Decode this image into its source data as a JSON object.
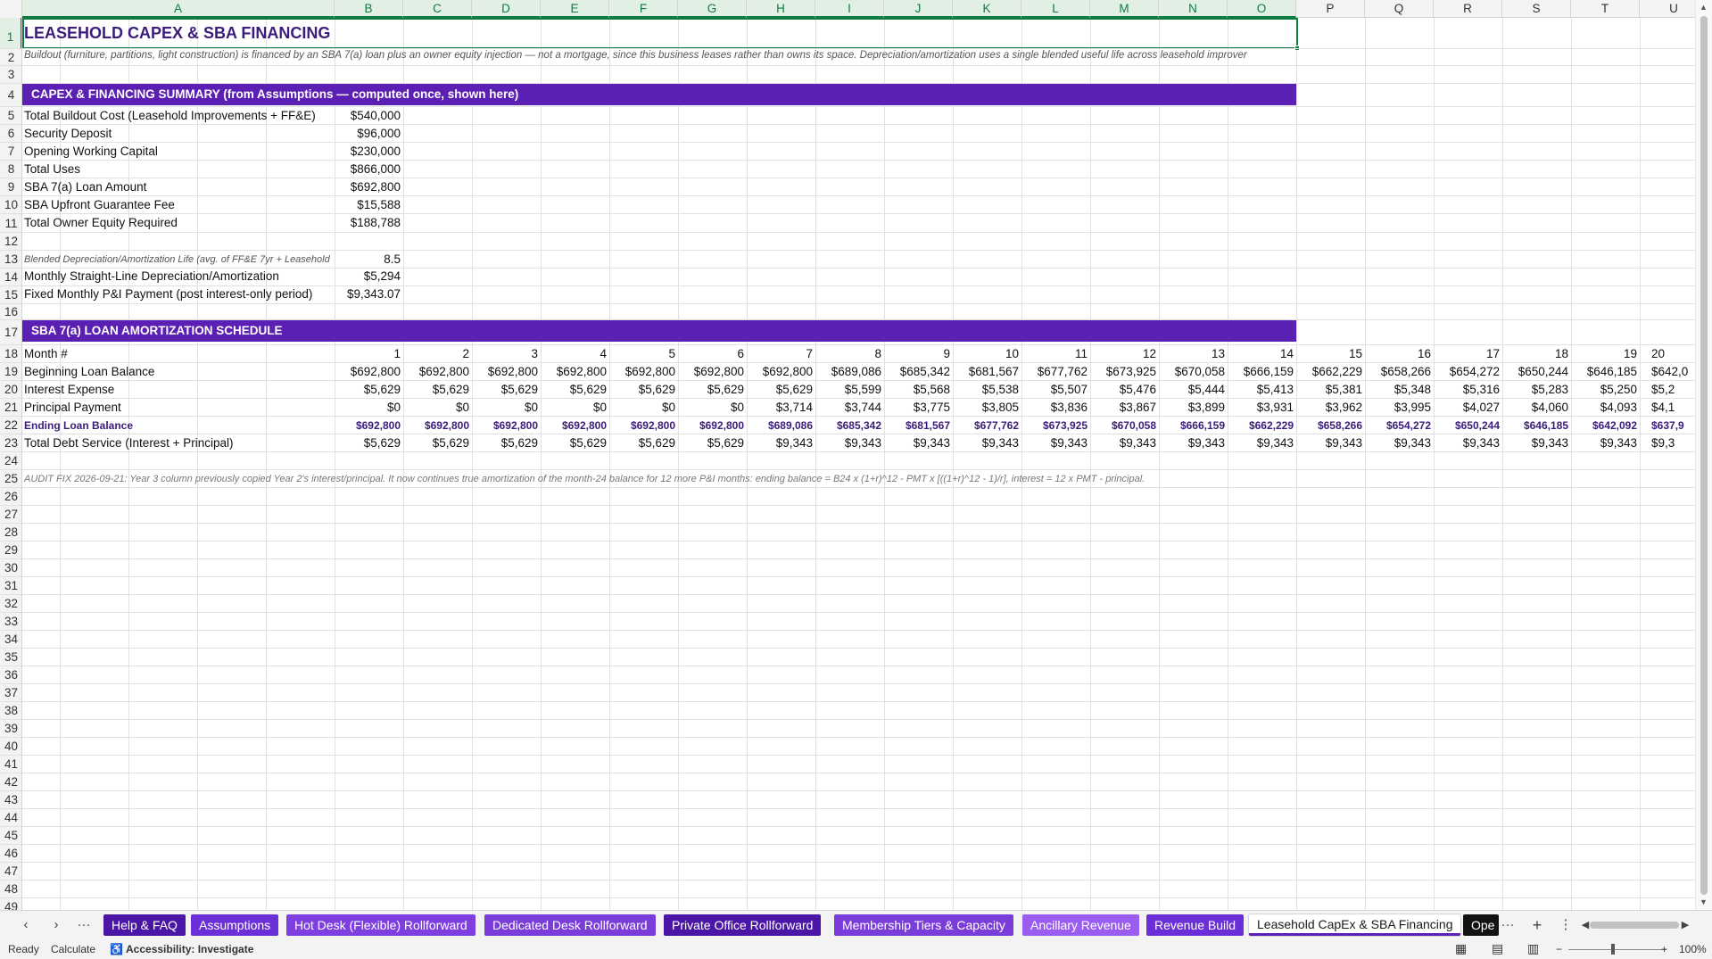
{
  "columns": [
    "A",
    "B",
    "C",
    "D",
    "E",
    "F",
    "G",
    "H",
    "I",
    "J",
    "K",
    "L",
    "M",
    "N",
    "O",
    "P",
    "Q",
    "R",
    "S",
    "T",
    "U"
  ],
  "rows": [
    "1",
    "2",
    "3",
    "4",
    "5",
    "6",
    "7",
    "8",
    "9",
    "10",
    "11",
    "12",
    "13",
    "14",
    "15",
    "16",
    "17",
    "18",
    "19",
    "20",
    "21",
    "22",
    "23",
    "24",
    "25",
    "26",
    "27",
    "28",
    "29",
    "30",
    "31",
    "32",
    "33",
    "34",
    "35",
    "36",
    "37",
    "38",
    "39",
    "40",
    "41",
    "42",
    "43",
    "44",
    "45",
    "46",
    "47",
    "48",
    "49"
  ],
  "sheet": {
    "title": "LEASEHOLD CAPEX & SBA FINANCING",
    "subtitle": "Buildout (furniture, partitions, light construction) is financed by an SBA 7(a) loan plus an owner equity injection — not a mortgage, since this business leases rather than owns its space. Depreciation/amortization uses a single blended useful life across leasehold improver",
    "summary_header": "CAPEX & FINANCING SUMMARY (from Assumptions — computed once, shown here)",
    "summary": [
      {
        "label": "Total Buildout Cost (Leasehold Improvements + FF&E)",
        "value": "$540,000"
      },
      {
        "label": "Security Deposit",
        "value": "$96,000"
      },
      {
        "label": "Opening Working Capital",
        "value": "$230,000"
      },
      {
        "label": "Total Uses",
        "value": "$866,000"
      },
      {
        "label": "SBA 7(a) Loan Amount",
        "value": "$692,800"
      },
      {
        "label": "SBA Upfront Guarantee Fee",
        "value": "$15,588"
      },
      {
        "label": "Total Owner Equity Required",
        "value": "$188,788"
      }
    ],
    "blended_life": {
      "label": "Blended Depreciation/Amortization Life (avg. of FF&E 7yr + Leasehold",
      "value": "8.5"
    },
    "monthly_dep": {
      "label": "Monthly Straight-Line Depreciation/Amortization",
      "value": "$5,294"
    },
    "fixed_pi": {
      "label": "Fixed Monthly P&I Payment (post interest-only period)",
      "value": "$9,343.07"
    },
    "amort_header": "SBA 7(a) LOAN AMORTIZATION SCHEDULE",
    "amort_rows": [
      {
        "label": "Month #",
        "values": [
          "1",
          "2",
          "3",
          "4",
          "5",
          "6",
          "7",
          "8",
          "9",
          "10",
          "11",
          "12",
          "13",
          "14",
          "15",
          "16",
          "17",
          "18",
          "19",
          "20"
        ]
      },
      {
        "label": "Beginning Loan Balance",
        "values": [
          "$692,800",
          "$692,800",
          "$692,800",
          "$692,800",
          "$692,800",
          "$692,800",
          "$692,800",
          "$689,086",
          "$685,342",
          "$681,567",
          "$677,762",
          "$673,925",
          "$670,058",
          "$666,159",
          "$662,229",
          "$658,266",
          "$654,272",
          "$650,244",
          "$646,185",
          "$642,0"
        ]
      },
      {
        "label": "Interest Expense",
        "values": [
          "$5,629",
          "$5,629",
          "$5,629",
          "$5,629",
          "$5,629",
          "$5,629",
          "$5,629",
          "$5,599",
          "$5,568",
          "$5,538",
          "$5,507",
          "$5,476",
          "$5,444",
          "$5,413",
          "$5,381",
          "$5,348",
          "$5,316",
          "$5,283",
          "$5,250",
          "$5,2"
        ]
      },
      {
        "label": "Principal Payment",
        "values": [
          "$0",
          "$0",
          "$0",
          "$0",
          "$0",
          "$0",
          "$3,714",
          "$3,744",
          "$3,775",
          "$3,805",
          "$3,836",
          "$3,867",
          "$3,899",
          "$3,931",
          "$3,962",
          "$3,995",
          "$4,027",
          "$4,060",
          "$4,093",
          "$4,1"
        ]
      },
      {
        "label": "Ending Loan Balance",
        "values": [
          "$692,800",
          "$692,800",
          "$692,800",
          "$692,800",
          "$692,800",
          "$692,800",
          "$689,086",
          "$685,342",
          "$681,567",
          "$677,762",
          "$673,925",
          "$670,058",
          "$666,159",
          "$662,229",
          "$658,266",
          "$654,272",
          "$650,244",
          "$646,185",
          "$642,092",
          "$637,9"
        ]
      },
      {
        "label": "Total Debt Service (Interest + Principal)",
        "values": [
          "$5,629",
          "$5,629",
          "$5,629",
          "$5,629",
          "$5,629",
          "$5,629",
          "$9,343",
          "$9,343",
          "$9,343",
          "$9,343",
          "$9,343",
          "$9,343",
          "$9,343",
          "$9,343",
          "$9,343",
          "$9,343",
          "$9,343",
          "$9,343",
          "$9,343",
          "$9,3"
        ]
      }
    ],
    "audit_note": "AUDIT FIX 2026-09-21: Year 3 column previously copied Year 2's interest/principal. It now continues true amortization of the month-24 balance for 12 more P&I months: ending balance = B24 x (1+r)^12 - PMT x [((1+r)^12 - 1)/r], interest = 12 x PMT - principal."
  },
  "tabs": [
    {
      "label": "Help & FAQ",
      "color": "#4b16a6"
    },
    {
      "label": "Assumptions",
      "color": "#6a2fd6"
    },
    {
      "label": "Hot Desk (Flexible) Rollforward",
      "color": "#7e3ee0"
    },
    {
      "label": "Dedicated Desk Rollforward",
      "color": "#7b3dd9"
    },
    {
      "label": "Private Office Rollforward",
      "color": "#4b16a6"
    },
    {
      "label": "Membership Tiers & Capacity",
      "color": "#7b3dd9"
    },
    {
      "label": "Ancillary Revenue",
      "color": "#9b5cf0"
    },
    {
      "label": "Revenue Build",
      "color": "#6a2fd6"
    },
    {
      "label": "Leasehold CapEx & SBA Financing",
      "color": "#ffffff"
    },
    {
      "label": "Ope",
      "color": "#111111"
    }
  ],
  "status": {
    "ready": "Ready",
    "calculate": "Calculate",
    "accessibility": "Accessibility: Investigate",
    "zoom": "100%"
  },
  "nav": {
    "prev": "‹",
    "next": "›",
    "more": "···",
    "add": "+",
    "options": "⋮"
  }
}
